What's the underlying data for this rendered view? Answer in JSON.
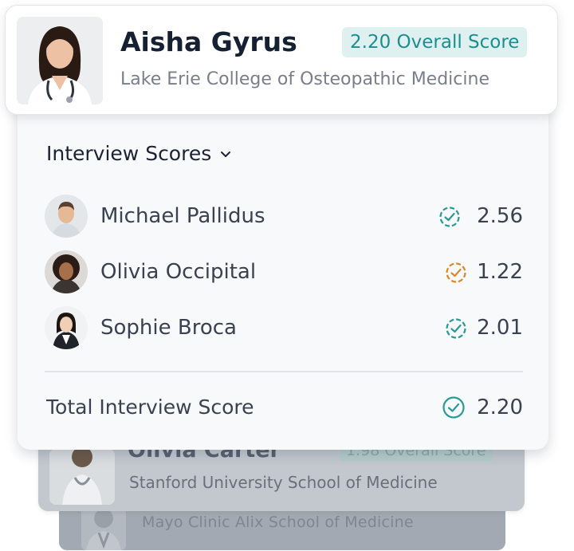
{
  "colors": {
    "accent_teal": "#1e8d8d",
    "badge_bg": "#dff0f1",
    "warning_orange": "#d88a2a",
    "text_dark": "#152033",
    "text_muted": "#787f8a"
  },
  "profile": {
    "name": "Aisha Gyrus",
    "school": "Lake Erie College of Osteopathic Medicine",
    "overall_score": "2.20 Overall Score",
    "photo_icon": "female-doctor-photo"
  },
  "interview": {
    "section_title": "Interview Scores",
    "toggle_icon": "chevron-down-icon",
    "interviewers": [
      {
        "name": "Michael Pallidus",
        "score": "2.56",
        "status": "teal",
        "status_icon": "check-circle-dashed-icon"
      },
      {
        "name": "Olivia Occipital",
        "score": "1.22",
        "status": "orange",
        "status_icon": "check-circle-dashed-icon"
      },
      {
        "name": "Sophie Broca",
        "score": "2.01",
        "status": "teal",
        "status_icon": "check-circle-dashed-icon"
      }
    ],
    "total_label": "Total Interview Score",
    "total_score": "2.20",
    "total_status_icon": "check-circle-icon"
  },
  "background_cards": [
    {
      "name": "Olivia Carter",
      "overall_score": "1.98 Overall Score",
      "school": "Stanford University School of Medicine"
    },
    {
      "school": "Mayo Clinic Alix School of Medicine"
    }
  ]
}
